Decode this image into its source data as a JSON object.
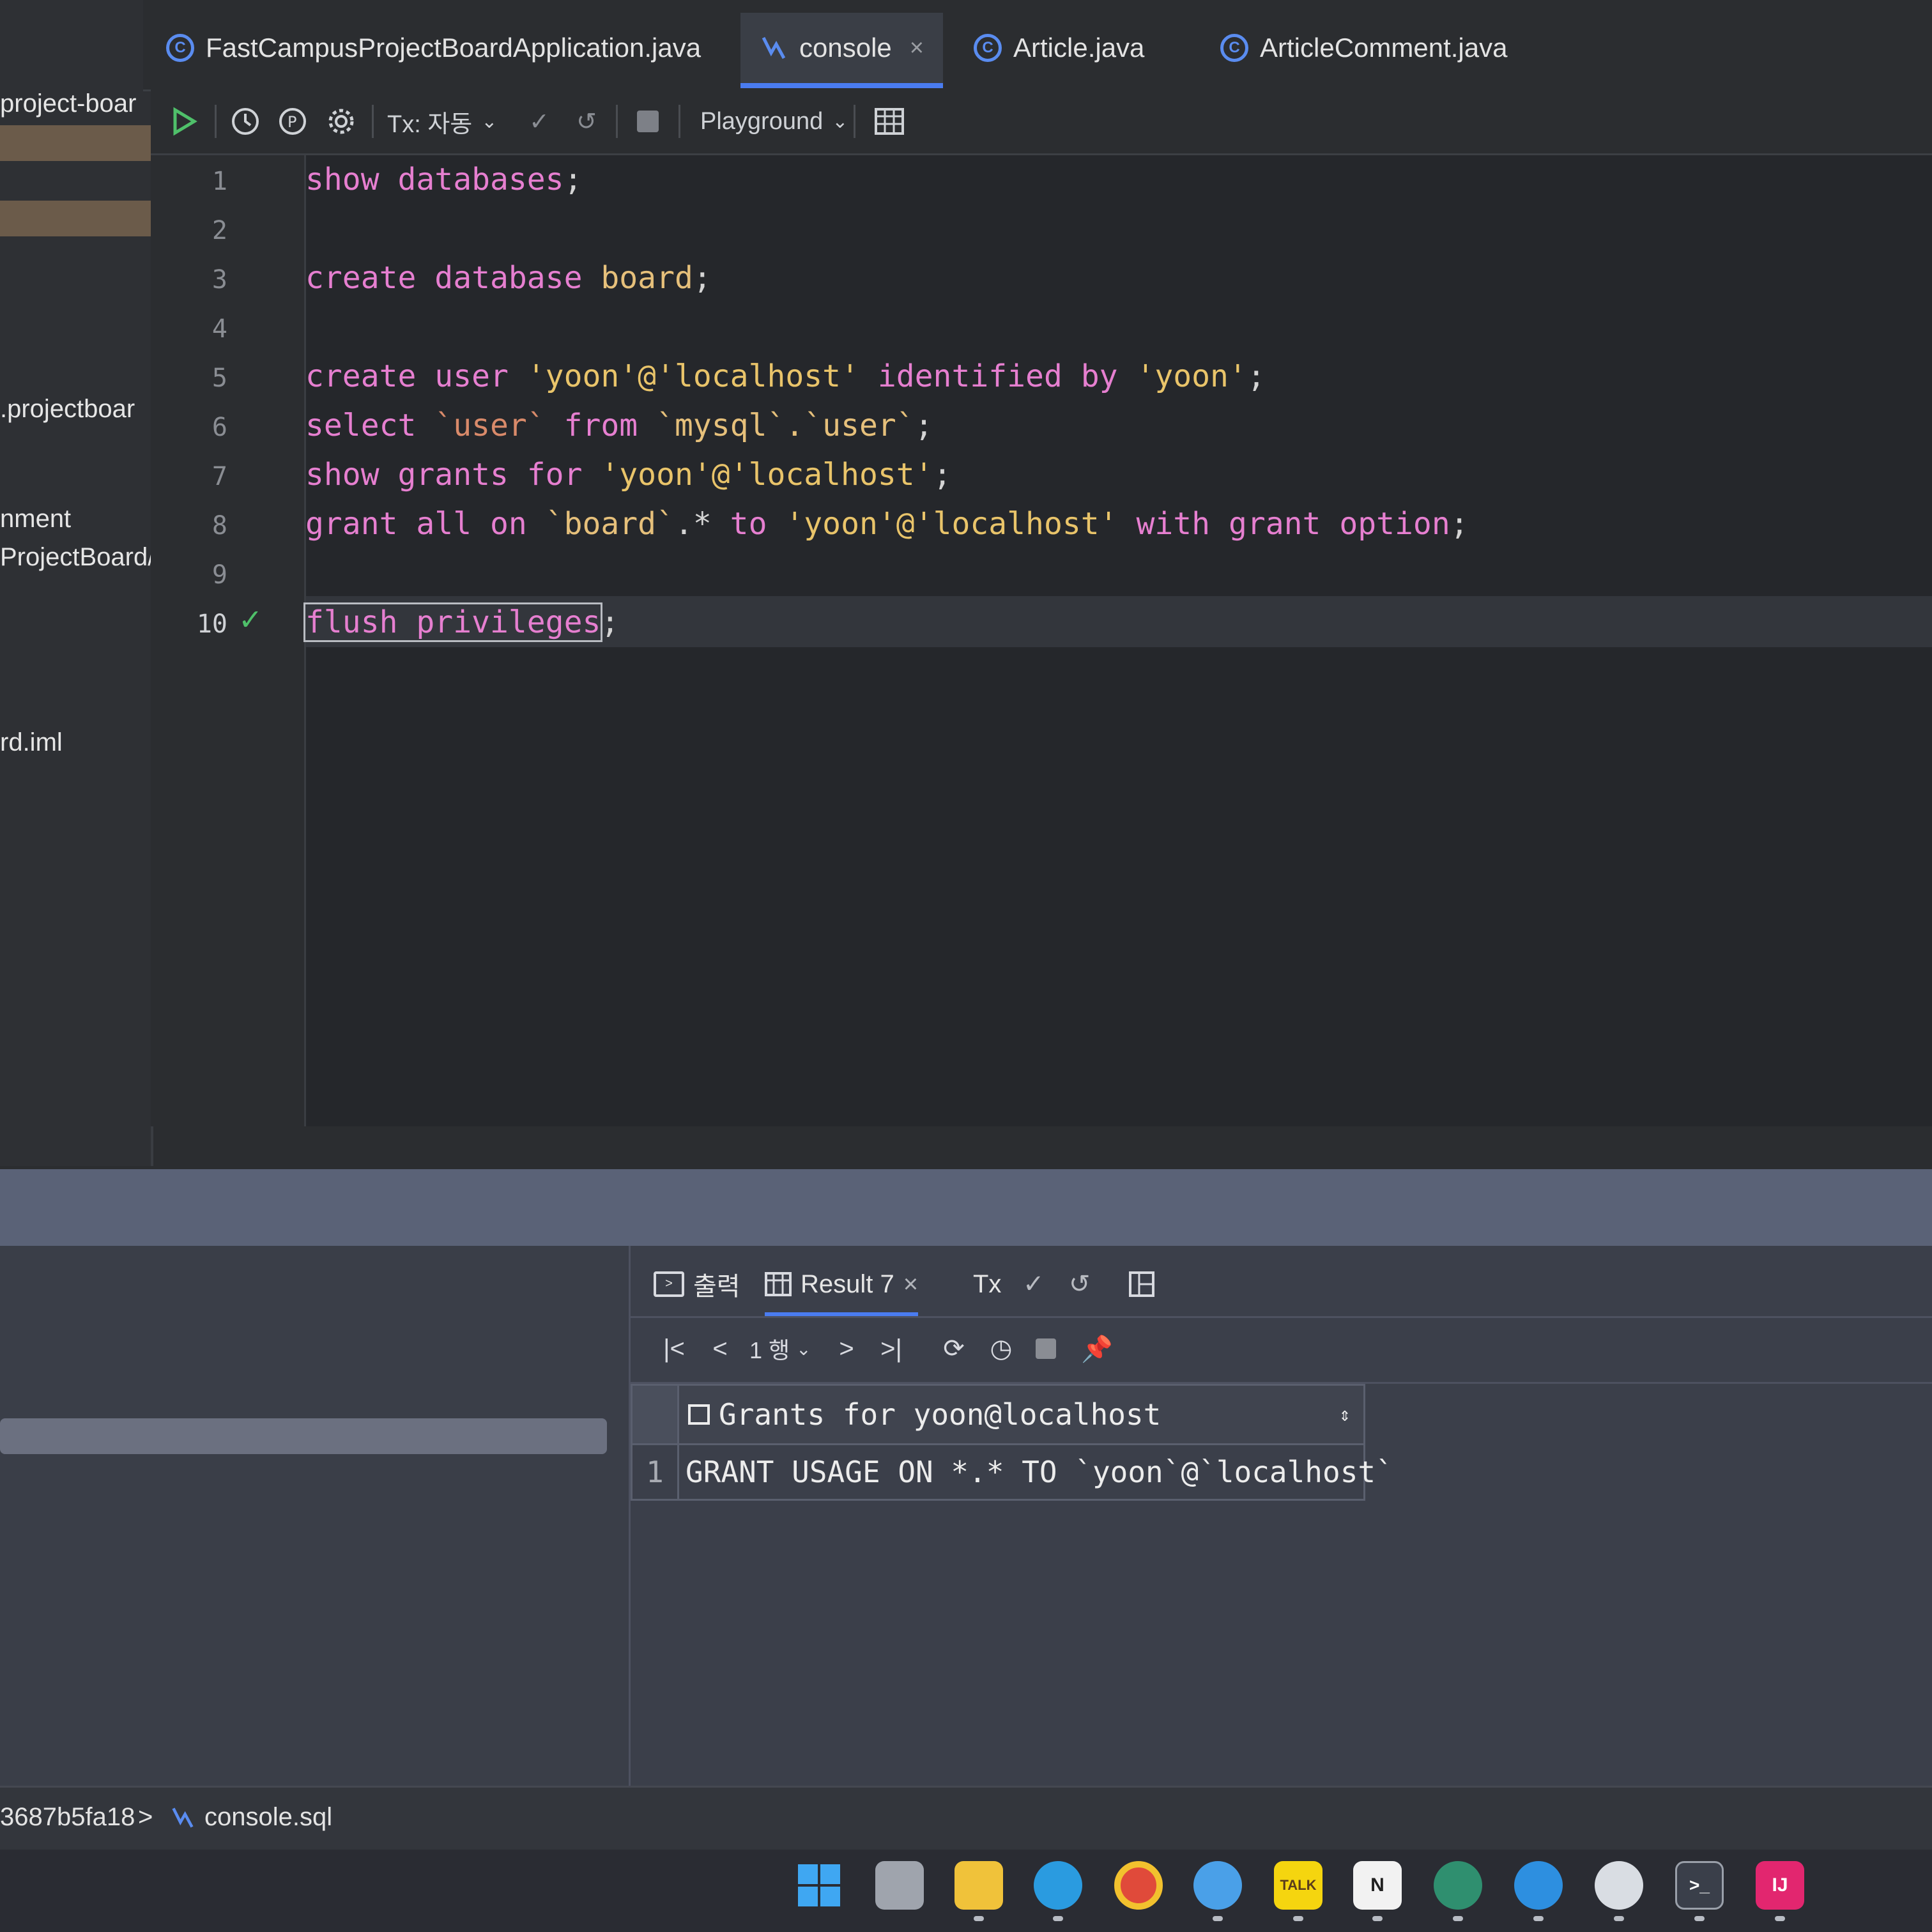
{
  "project_panel": {
    "items": [
      "project-boar",
      ".projectboar",
      "nment",
      "ProjectBoard/",
      "rd.iml"
    ]
  },
  "tabs": [
    {
      "label": "FastCampusProjectBoardApplication.java",
      "icon": "spring-class-icon"
    },
    {
      "label": "console",
      "icon": "sql-console-icon",
      "active": true
    },
    {
      "label": "Article.java",
      "icon": "class-icon"
    },
    {
      "label": "ArticleComment.java",
      "icon": "class-icon"
    }
  ],
  "toolbar": {
    "tx_mode": "Tx: 자동",
    "session": "Playground"
  },
  "editor": {
    "line_numbers": [
      "1",
      "2",
      "3",
      "4",
      "5",
      "6",
      "7",
      "8",
      "9",
      "10"
    ],
    "current_line": "10",
    "lines": [
      "show databases;",
      "",
      "create database board;",
      "",
      "create user 'yoon'@'localhost' identified by 'yoon';",
      "select `user` from `mysql`.`user`;",
      "show grants for 'yoon'@'localhost';",
      "grant all on `board`.* to 'yoon'@'localhost' with grant option;",
      "",
      "flush privileges;"
    ]
  },
  "results": {
    "output_tab": "출력",
    "result_tab": "Result 7",
    "tx_label": "Tx",
    "page_selector": "1 행",
    "column_header": "Grants for yoon@localhost",
    "rows": [
      {
        "num": "1",
        "value": "GRANT USAGE ON *.* TO `yoon`@`localhost`"
      }
    ]
  },
  "status_bar": {
    "path_hash": "3687b5fa18",
    "separator": ">",
    "file": "console.sql"
  },
  "taskbar": {
    "apps": [
      "windows-start",
      "task-view",
      "file-explorer",
      "edge",
      "chrome",
      "browser",
      "kakaotalk",
      "notion",
      "app-green",
      "docker",
      "app-white",
      "terminal",
      "intellij"
    ]
  },
  "colors": {
    "accent": "#4a7cf0",
    "keyword": "#e67fd0",
    "string": "#e9c46a",
    "success": "#4fc06a"
  }
}
